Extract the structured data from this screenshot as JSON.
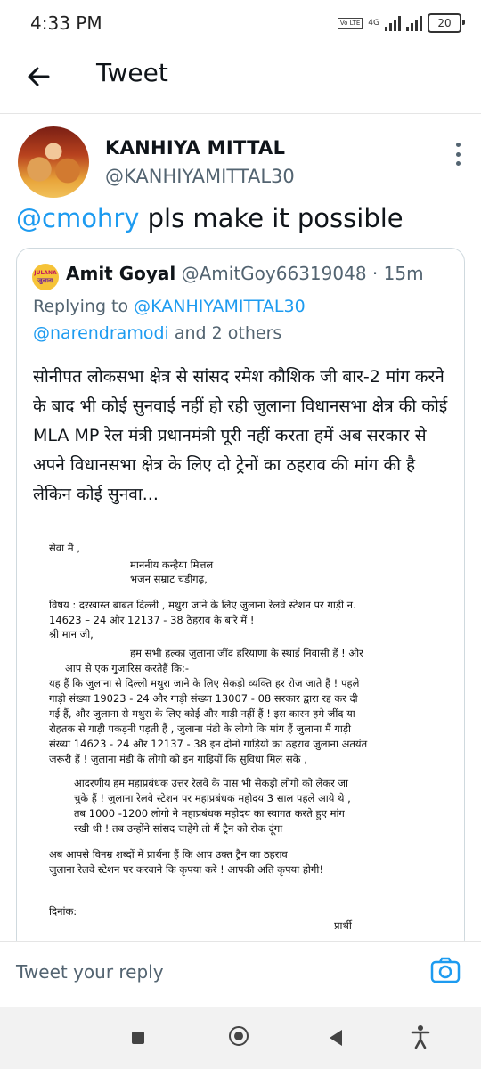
{
  "status_bar": {
    "time": "4:33 PM",
    "network": "4G",
    "volte": "Vo LTE",
    "battery": "20"
  },
  "app_bar": {
    "title": "Tweet"
  },
  "tweet": {
    "author_name": "KANHIYA MITTAL",
    "author_handle": "@KANHIYAMITTAL30",
    "text_mention": "@cmohry",
    "text_rest": " pls make it possible"
  },
  "quoted": {
    "avatar_top": "JULANA",
    "avatar_bottom": "जुलाना",
    "author_name": "Amit Goyal",
    "author_handle": "@AmitGoy66319048",
    "separator": "·",
    "time": "15m",
    "replying_prefix": "Replying to ",
    "replying_handle": "@KANHIYAMITTAL30",
    "replying_line2_handle": "@narendramodi",
    "replying_line2_rest": " and 2 others",
    "body": "सोनीपत लोकसभा क्षेत्र से सांसद रमेश कौशिक जी बार-2 मांग करने के बाद भी कोई सुनवाई नहीं हो रही जुलाना विधानसभा क्षेत्र की कोई MLA MP रेल मंत्री प्रधानमंत्री पूरी नहीं करता हमें अब सरकार से अपने विधानसभा क्षेत्र के लिए दो ट्रेनों का ठहराव की मांग की है लेकिन कोई सुनवा...",
    "letter": {
      "l1": "सेवा मैं ,",
      "l2": "माननीय कन्हैया मित्तल",
      "l3": "भजन सम्राट चंडीगढ़,",
      "l4": "विषय :      दरखास्त बाबत दिल्ली , मथुरा जाने के लिए जुलाना रेलवे स्टेशन पर गाड़ी न.",
      "l5": "14623 – 24 और   12137 - 38 ठेहराव के बारे में !",
      "l6": "श्री मान जी,",
      "l7": "हम सभी हल्का जुलाना जींद हरियाणा के स्थाई निवासी हैं ! और",
      "l8": "आप से एक गुजारिस करतेहैं कि:-",
      "l9": "यह हैं कि जुलाना से दिल्ली मथुरा जाने के लिए सेकड़ो व्यक्ति हर रोज जाते हैं ! पहले",
      "l10": "गाड़ी संख्या 19023 - 24  और गाड़ी संख्या 13007 - 08 सरकार द्वारा रद्द कर दी",
      "l11": "गई हैं, और जुलाना से मथुरा के लिए कोई और गाड़ी नहीं हैं ! इस कारन हमे जींद या",
      "l12": "रोहतक से गाड़ी  पकड़नी पड़ती हैं , जुलाना मंडी के लोगो कि मांग हैं जुलाना मैं गाड़ी",
      "l13": "संख्या 14623 - 24 और 12137 - 38 इन दोनों गाड़ियों का ठहराव जुलाना अतयंत",
      "l14": "जरूरी हैं ! जुलाना मंडी के लोगो को इन गाड़ियों कि सुविधा मिल सके ,",
      "l15": "आदरणीय हम महाप्रबंधक उत्तर रेलवे के पास भी सेकड़ो लोगो को लेकर जा",
      "l16": "चुके हैं ! जुलाना  रेलवे स्टेशन पर महाप्रबंधक  महोदय 3  साल पहले आये थे ,",
      "l17": "तब 1000  -1200 लोगो ने महाप्रबंधक महोदय का स्वागत करते हुए मांग",
      "l18": "रखी थी ! तब उन्होंने सांसद चाहेंगे तो मैं ट्रैन को रोक दूंगा",
      "l19": "अब आपसे विनम्र  शब्दों में प्रार्थना हैं कि आप उक्त ट्रैन  का ठहराव",
      "l20": "जुलाना रेलवे स्टेशन पर करवाने कि कृपया करे ! आपकी अति कृपया होगी!",
      "l21": "दिनांक:",
      "l22": "प्रार्थी"
    }
  },
  "reply_bar": {
    "placeholder": "Tweet your reply"
  },
  "icons": {
    "back": "arrow-left-icon",
    "camera": "camera-icon",
    "more": "more-vertical-icon"
  },
  "colors": {
    "accent": "#1d9bf0",
    "muted": "#536471",
    "text": "#0f1419"
  }
}
